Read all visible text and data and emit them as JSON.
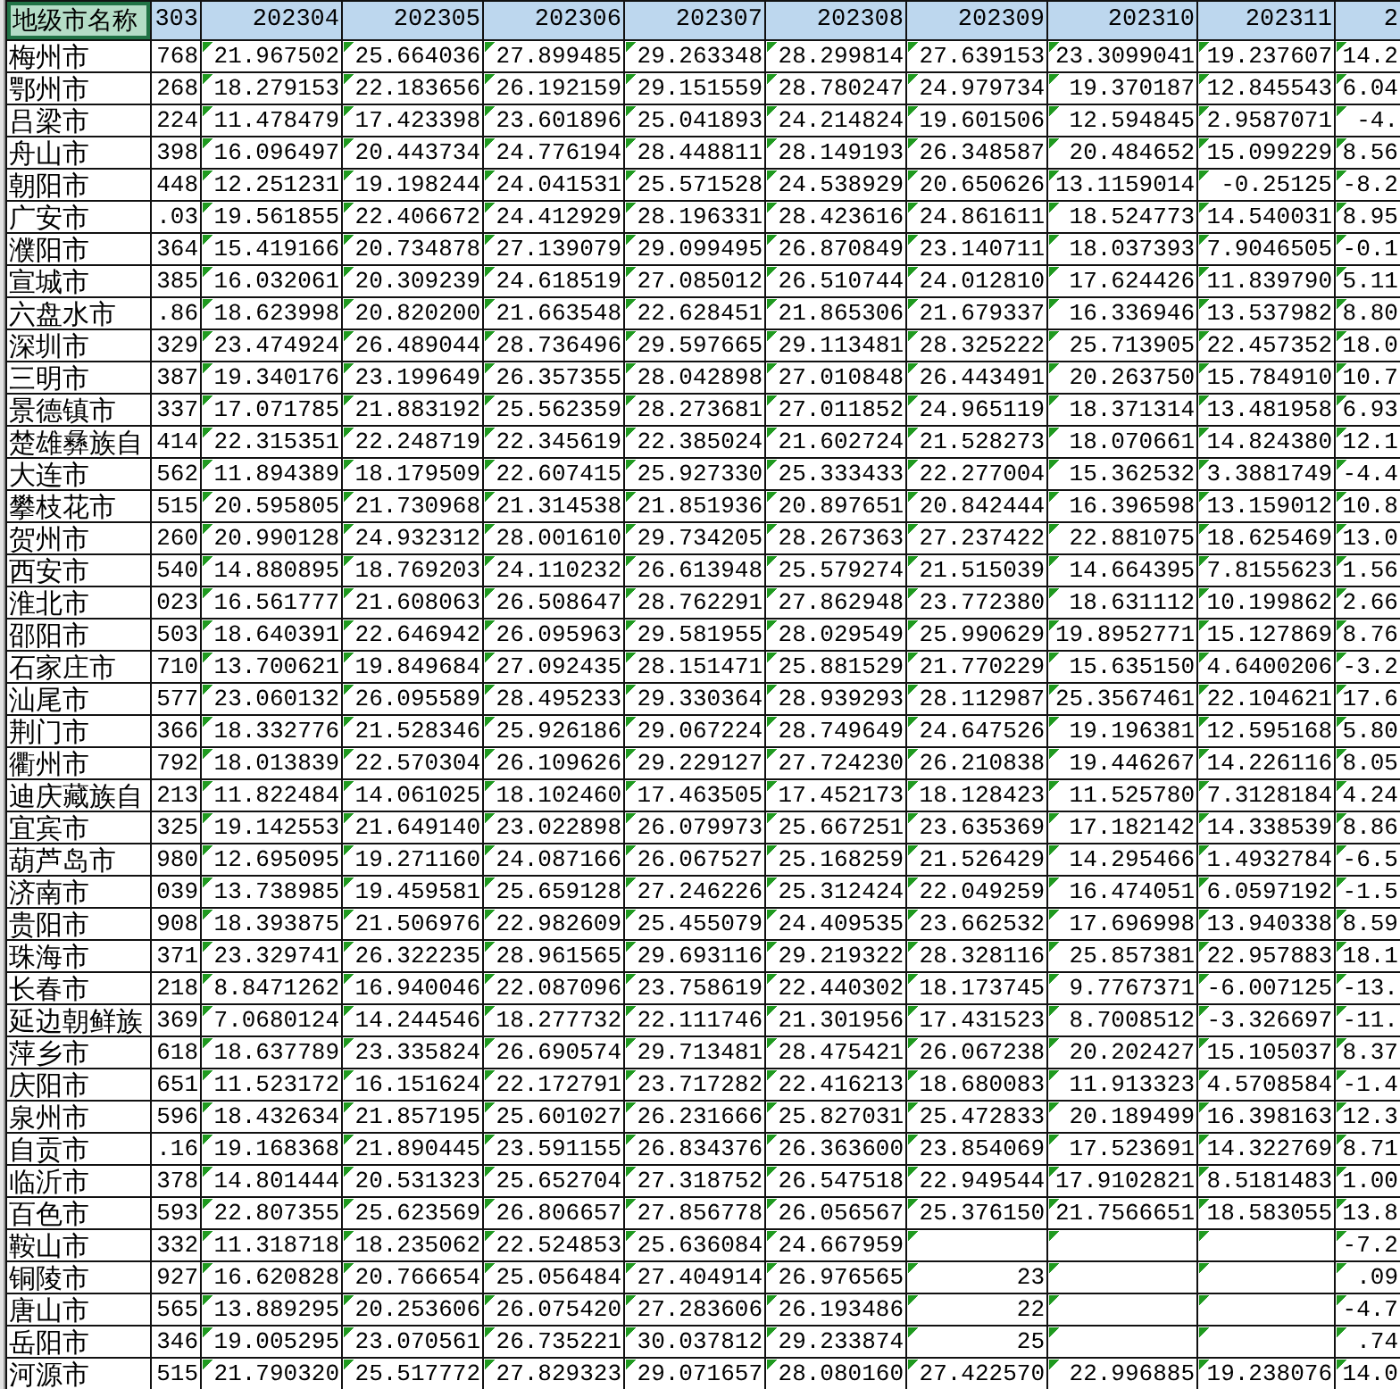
{
  "columns": [
    {
      "label": "地级市名称",
      "selected": true
    },
    {
      "label": "303",
      "selected": false
    },
    {
      "label": "202304",
      "selected": false
    },
    {
      "label": "202305",
      "selected": false
    },
    {
      "label": "202306",
      "selected": false
    },
    {
      "label": "202307",
      "selected": false
    },
    {
      "label": "202308",
      "selected": false
    },
    {
      "label": "202309",
      "selected": false
    },
    {
      "label": "202310",
      "selected": false
    },
    {
      "label": "202311",
      "selected": false
    },
    {
      "label": "2",
      "selected": false
    }
  ],
  "rows": [
    {
      "column_1": "梅州市",
      "column_2": "768",
      "column_3": "21.967502",
      "column_4": "25.664036",
      "column_5": "27.899485",
      "column_6": "29.263348",
      "column_7": "28.299814",
      "column_8": "27.639153",
      "column_9": "23.3099041",
      "column_10": "19.237607",
      "column_11": "14.2"
    },
    {
      "column_1": "鄂州市",
      "column_2": "268",
      "column_3": "18.279153",
      "column_4": "22.183656",
      "column_5": "26.192159",
      "column_6": "29.151559",
      "column_7": "28.780247",
      "column_8": "24.979734",
      "column_9": "19.370187",
      "column_10": "12.845543",
      "column_11": "6.04"
    },
    {
      "column_1": "吕梁市",
      "column_2": "224",
      "column_3": "11.478479",
      "column_4": "17.423398",
      "column_5": "23.601896",
      "column_6": "25.041893",
      "column_7": "24.214824",
      "column_8": "19.601506",
      "column_9": "12.594845",
      "column_10": "2.9587071",
      "column_11": "-4."
    },
    {
      "column_1": "舟山市",
      "column_2": "398",
      "column_3": "16.096497",
      "column_4": "20.443734",
      "column_5": "24.776194",
      "column_6": "28.448811",
      "column_7": "28.149193",
      "column_8": "26.348587",
      "column_9": "20.484652",
      "column_10": "15.099229",
      "column_11": "8.56"
    },
    {
      "column_1": "朝阳市",
      "column_2": "448",
      "column_3": "12.251231",
      "column_4": "19.198244",
      "column_5": "24.041531",
      "column_6": "25.571528",
      "column_7": "24.538929",
      "column_8": "20.650626",
      "column_9": "13.1159014",
      "column_10": "-0.25125",
      "column_11": "-8.2"
    },
    {
      "column_1": "广安市",
      "column_2": ".03",
      "column_3": "19.561855",
      "column_4": "22.406672",
      "column_5": "24.412929",
      "column_6": "28.196331",
      "column_7": "28.423616",
      "column_8": "24.861611",
      "column_9": "18.524773",
      "column_10": "14.540031",
      "column_11": "8.95"
    },
    {
      "column_1": "濮阳市",
      "column_2": "364",
      "column_3": "15.419166",
      "column_4": "20.734878",
      "column_5": "27.139079",
      "column_6": "29.099495",
      "column_7": "26.870849",
      "column_8": "23.140711",
      "column_9": "18.037393",
      "column_10": "7.9046505",
      "column_11": "-0.1"
    },
    {
      "column_1": "宣城市",
      "column_2": "385",
      "column_3": "16.032061",
      "column_4": "20.309239",
      "column_5": "24.618519",
      "column_6": "27.085012",
      "column_7": "26.510744",
      "column_8": "24.012810",
      "column_9": "17.624426",
      "column_10": "11.839790",
      "column_11": "5.11"
    },
    {
      "column_1": "六盘水市",
      "column_2": ".86",
      "column_3": "18.623998",
      "column_4": "20.820200",
      "column_5": "21.663548",
      "column_6": "22.628451",
      "column_7": "21.865306",
      "column_8": "21.679337",
      "column_9": "16.336946",
      "column_10": "13.537982",
      "column_11": "8.80"
    },
    {
      "column_1": "深圳市",
      "column_2": "329",
      "column_3": "23.474924",
      "column_4": "26.489044",
      "column_5": "28.736496",
      "column_6": "29.597665",
      "column_7": "29.113481",
      "column_8": "28.325222",
      "column_9": "25.713905",
      "column_10": "22.457352",
      "column_11": "18.0"
    },
    {
      "column_1": "三明市",
      "column_2": "387",
      "column_3": "19.340176",
      "column_4": "23.199649",
      "column_5": "26.357355",
      "column_6": "28.042898",
      "column_7": "27.010848",
      "column_8": "26.443491",
      "column_9": "20.263750",
      "column_10": "15.784910",
      "column_11": "10.7"
    },
    {
      "column_1": "景德镇市",
      "column_2": "337",
      "column_3": "17.071785",
      "column_4": "21.883192",
      "column_5": "25.562359",
      "column_6": "28.273681",
      "column_7": "27.011852",
      "column_8": "24.965119",
      "column_9": "18.371314",
      "column_10": "13.481958",
      "column_11": "6.93"
    },
    {
      "column_1": "楚雄彝族自",
      "column_2": "414",
      "column_3": "22.315351",
      "column_4": "22.248719",
      "column_5": "22.345619",
      "column_6": "22.385024",
      "column_7": "21.602724",
      "column_8": "21.528273",
      "column_9": "18.070661",
      "column_10": "14.824380",
      "column_11": "12.1"
    },
    {
      "column_1": "大连市",
      "column_2": "562",
      "column_3": "11.894389",
      "column_4": "18.179509",
      "column_5": "22.607415",
      "column_6": "25.927330",
      "column_7": "25.333433",
      "column_8": "22.277004",
      "column_9": "15.362532",
      "column_10": "3.3881749",
      "column_11": "-4.4"
    },
    {
      "column_1": "攀枝花市",
      "column_2": "515",
      "column_3": "20.595805",
      "column_4": "21.730968",
      "column_5": "21.314538",
      "column_6": "21.851936",
      "column_7": "20.897651",
      "column_8": "20.842444",
      "column_9": "16.396598",
      "column_10": "13.159012",
      "column_11": "10.8"
    },
    {
      "column_1": "贺州市",
      "column_2": "260",
      "column_3": "20.990128",
      "column_4": "24.932312",
      "column_5": "28.001610",
      "column_6": "29.734205",
      "column_7": "28.267363",
      "column_8": "27.237422",
      "column_9": "22.881075",
      "column_10": "18.625469",
      "column_11": "13.0"
    },
    {
      "column_1": "西安市",
      "column_2": "540",
      "column_3": "14.880895",
      "column_4": "18.769203",
      "column_5": "24.110232",
      "column_6": "26.613948",
      "column_7": "25.579274",
      "column_8": "21.515039",
      "column_9": "14.664395",
      "column_10": "7.8155623",
      "column_11": "1.56"
    },
    {
      "column_1": "淮北市",
      "column_2": "023",
      "column_3": "16.561777",
      "column_4": "21.608063",
      "column_5": "26.508647",
      "column_6": "28.762291",
      "column_7": "27.862948",
      "column_8": "23.772380",
      "column_9": "18.631112",
      "column_10": "10.199862",
      "column_11": "2.66"
    },
    {
      "column_1": "邵阳市",
      "column_2": "503",
      "column_3": "18.640391",
      "column_4": "22.646942",
      "column_5": "26.095963",
      "column_6": "29.581955",
      "column_7": "28.029549",
      "column_8": "25.990629",
      "column_9": "19.8952771",
      "column_10": "15.127869",
      "column_11": "8.76"
    },
    {
      "column_1": "石家庄市",
      "column_2": "710",
      "column_3": "13.700621",
      "column_4": "19.849684",
      "column_5": "27.092435",
      "column_6": "28.151471",
      "column_7": "25.881529",
      "column_8": "21.770229",
      "column_9": "15.635150",
      "column_10": "4.6400206",
      "column_11": "-3.2"
    },
    {
      "column_1": "汕尾市",
      "column_2": "577",
      "column_3": "23.060132",
      "column_4": "26.095589",
      "column_5": "28.495233",
      "column_6": "29.330364",
      "column_7": "28.939293",
      "column_8": "28.112987",
      "column_9": "25.3567461",
      "column_10": "22.104621",
      "column_11": "17.6"
    },
    {
      "column_1": "荆门市",
      "column_2": "366",
      "column_3": "18.332776",
      "column_4": "21.528346",
      "column_5": "25.926186",
      "column_6": "29.067224",
      "column_7": "28.749649",
      "column_8": "24.647526",
      "column_9": "19.196381",
      "column_10": "12.595168",
      "column_11": "5.80"
    },
    {
      "column_1": "衢州市",
      "column_2": "792",
      "column_3": "18.013839",
      "column_4": "22.570304",
      "column_5": "26.109626",
      "column_6": "29.229127",
      "column_7": "27.724230",
      "column_8": "26.210838",
      "column_9": "19.446267",
      "column_10": "14.226116",
      "column_11": "8.05"
    },
    {
      "column_1": "迪庆藏族自",
      "column_2": "213",
      "column_3": "11.822484",
      "column_4": "14.061025",
      "column_5": "18.102460",
      "column_6": "17.463505",
      "column_7": "17.452173",
      "column_8": "18.128423",
      "column_9": "11.525780",
      "column_10": "7.3128184",
      "column_11": "4.24"
    },
    {
      "column_1": "宜宾市",
      "column_2": "325",
      "column_3": "19.142553",
      "column_4": "21.649140",
      "column_5": "23.022898",
      "column_6": "26.079973",
      "column_7": "25.667251",
      "column_8": "23.635369",
      "column_9": "17.182142",
      "column_10": "14.338539",
      "column_11": "8.86"
    },
    {
      "column_1": "葫芦岛市",
      "column_2": "980",
      "column_3": "12.695095",
      "column_4": "19.271160",
      "column_5": "24.087166",
      "column_6": "26.067527",
      "column_7": "25.168259",
      "column_8": "21.526429",
      "column_9": "14.295466",
      "column_10": "1.4932784",
      "column_11": "-6.5"
    },
    {
      "column_1": "济南市",
      "column_2": "039",
      "column_3": "13.738985",
      "column_4": "19.459581",
      "column_5": "25.659128",
      "column_6": "27.246226",
      "column_7": "25.312424",
      "column_8": "22.049259",
      "column_9": "16.474051",
      "column_10": "6.0597192",
      "column_11": "-1.5"
    },
    {
      "column_1": "贵阳市",
      "column_2": "908",
      "column_3": "18.393875",
      "column_4": "21.506976",
      "column_5": "22.982609",
      "column_6": "25.455079",
      "column_7": "24.409535",
      "column_8": "23.662532",
      "column_9": "17.696998",
      "column_10": "13.940338",
      "column_11": "8.59"
    },
    {
      "column_1": "珠海市",
      "column_2": "371",
      "column_3": "23.329741",
      "column_4": "26.322235",
      "column_5": "28.961565",
      "column_6": "29.693116",
      "column_7": "29.219322",
      "column_8": "28.328116",
      "column_9": "25.857381",
      "column_10": "22.957883",
      "column_11": "18.1"
    },
    {
      "column_1": "长春市",
      "column_2": "218",
      "column_3": "8.8471262",
      "column_4": "16.940046",
      "column_5": "22.087096",
      "column_6": "23.758619",
      "column_7": "22.440302",
      "column_8": "18.173745",
      "column_9": "9.7767371",
      "column_10": "-6.007125",
      "column_11": "-13."
    },
    {
      "column_1": "延边朝鲜族",
      "column_2": "369",
      "column_3": "7.0680124",
      "column_4": "14.244546",
      "column_5": "18.277732",
      "column_6": "22.111746",
      "column_7": "21.301956",
      "column_8": "17.431523",
      "column_9": "8.7008512",
      "column_10": "-3.326697",
      "column_11": "-11."
    },
    {
      "column_1": "萍乡市",
      "column_2": "618",
      "column_3": "18.637789",
      "column_4": "23.335824",
      "column_5": "26.690574",
      "column_6": "29.713481",
      "column_7": "28.475421",
      "column_8": "26.067238",
      "column_9": "20.202427",
      "column_10": "15.105037",
      "column_11": "8.37"
    },
    {
      "column_1": "庆阳市",
      "column_2": "651",
      "column_3": "11.523172",
      "column_4": "16.151624",
      "column_5": "22.172791",
      "column_6": "23.717282",
      "column_7": "22.416213",
      "column_8": "18.680083",
      "column_9": "11.913323",
      "column_10": "4.5708584",
      "column_11": "-1.4"
    },
    {
      "column_1": "泉州市",
      "column_2": "596",
      "column_3": "18.432634",
      "column_4": "21.857195",
      "column_5": "25.601027",
      "column_6": "26.231666",
      "column_7": "25.827031",
      "column_8": "25.472833",
      "column_9": "20.189499",
      "column_10": "16.398163",
      "column_11": "12.3"
    },
    {
      "column_1": "自贡市",
      "column_2": ".16",
      "column_3": "19.168368",
      "column_4": "21.890445",
      "column_5": "23.591155",
      "column_6": "26.834376",
      "column_7": "26.363600",
      "column_8": "23.854069",
      "column_9": "17.523691",
      "column_10": "14.322769",
      "column_11": "8.71"
    },
    {
      "column_1": "临沂市",
      "column_2": "378",
      "column_3": "14.801444",
      "column_4": "20.531323",
      "column_5": "25.652704",
      "column_6": "27.318752",
      "column_7": "26.547518",
      "column_8": "22.949544",
      "column_9": "17.9102821",
      "column_10": "8.5181483",
      "column_11": "1.00"
    },
    {
      "column_1": "百色市",
      "column_2": "593",
      "column_3": "22.807355",
      "column_4": "25.623569",
      "column_5": "26.806657",
      "column_6": "27.856778",
      "column_7": "26.056567",
      "column_8": "25.376150",
      "column_9": "21.7566651",
      "column_10": "18.583055",
      "column_11": "13.8"
    },
    {
      "column_1": "鞍山市",
      "column_2": "332",
      "column_3": "11.318718",
      "column_4": "18.235062",
      "column_5": "22.524853",
      "column_6": "25.636084",
      "column_7": "24.667959",
      "column_11": "-7.2"
    },
    {
      "column_1": "铜陵市",
      "column_2": "927",
      "column_3": "16.620828",
      "column_4": "20.766654",
      "column_5": "25.056484",
      "column_6": "27.404914",
      "column_7": "26.976565",
      "column_8": "23",
      "column_11": ".09"
    },
    {
      "column_1": "唐山市",
      "column_2": "565",
      "column_3": "13.889295",
      "column_4": "20.253606",
      "column_5": "26.075420",
      "column_6": "27.283606",
      "column_7": "26.193486",
      "column_8": "22",
      "column_11": "-4.7"
    },
    {
      "column_1": "岳阳市",
      "column_2": "346",
      "column_3": "19.005295",
      "column_4": "23.070561",
      "column_5": "26.735221",
      "column_6": "30.037812",
      "column_7": "29.233874",
      "column_8": "25",
      "column_11": ".74"
    },
    {
      "column_1": "河源市",
      "column_2": "515",
      "column_3": "21.790320",
      "column_4": "25.517772",
      "column_5": "27.829323",
      "column_6": "29.071657",
      "column_7": "28.080160",
      "column_8": "27.422570",
      "column_9": "22.996885",
      "column_10": "19.238076",
      "column_11": "14.0"
    }
  ]
}
